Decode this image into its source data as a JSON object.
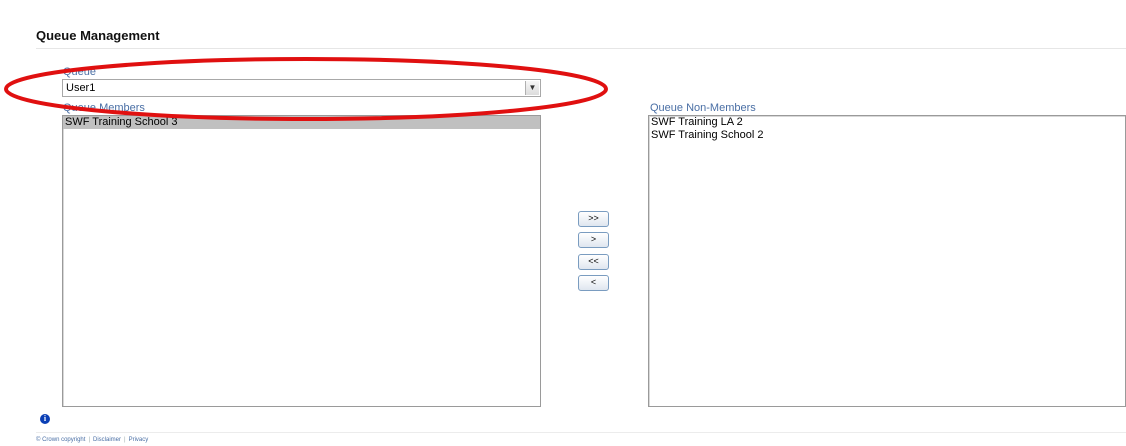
{
  "page": {
    "title": "Queue Management"
  },
  "queue": {
    "label": "Queue",
    "selected_value": "User1"
  },
  "members": {
    "label": "Queue Members",
    "items": [
      "SWF Training School 3"
    ],
    "selected_index": 0
  },
  "non_members": {
    "label": "Queue Non-Members",
    "items": [
      "SWF Training LA 2",
      "SWF Training School 2"
    ]
  },
  "move_buttons": {
    "add_all": ">>",
    "add": ">",
    "remove_all": "<<",
    "remove": "<"
  },
  "footer": {
    "copyright": "© Crown copyright",
    "disclaimer": "Disclaimer",
    "privacy": "Privacy"
  },
  "annotation": {
    "color": "#e01010",
    "shape": "ellipse"
  }
}
